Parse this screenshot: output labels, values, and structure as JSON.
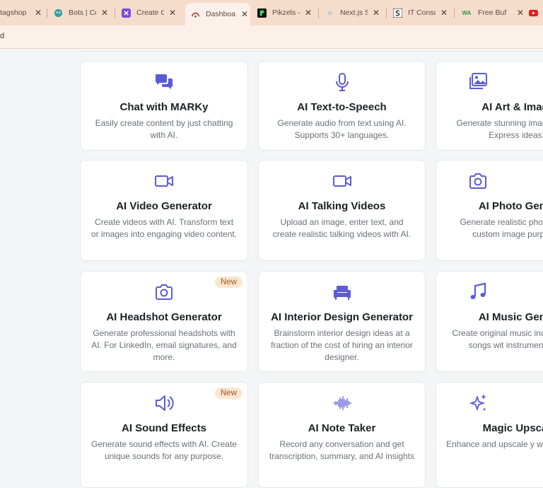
{
  "browser": {
    "tabs": [
      {
        "title": "tagshop",
        "icon": "tagshop-icon"
      },
      {
        "title": "Bots | Co",
        "icon": "bot-icon"
      },
      {
        "title": "Create C",
        "icon": "create-icon"
      },
      {
        "title": "Dashboa",
        "icon": "dashboard-icon",
        "active": true
      },
      {
        "title": "Pikzels -",
        "icon": "pikzels-icon"
      },
      {
        "title": "Next.js S",
        "icon": "nextjs-icon"
      },
      {
        "title": "IT Consu",
        "icon": "it-consult-icon"
      },
      {
        "title": "Free Buf",
        "icon": "whatsapp-icon",
        "icon_text": "WA"
      },
      {
        "title": "",
        "icon": "youtube-icon"
      }
    ],
    "url_fragment": "d"
  },
  "colors": {
    "accent": "#5b5bd6",
    "badge_bg": "#fde6cf",
    "badge_text": "#9a5a2a"
  },
  "cards": [
    {
      "title": "Chat with MARKy",
      "desc": "Easily create content by just chatting with AI.",
      "icon": "chat-icon"
    },
    {
      "title": "AI Text-to-Speech",
      "desc": "Generate audio from text using AI. Supports 30+ languages.",
      "icon": "microphone-icon"
    },
    {
      "title": "AI Art & Imag",
      "desc": "Generate stunning imag with AI. Express ideas.",
      "icon": "images-icon"
    },
    {
      "title": "AI Video Generator",
      "desc": "Create videos with AI. Transform text or images into engaging video content.",
      "icon": "video-icon"
    },
    {
      "title": "AI Talking Videos",
      "desc": "Upload an image, enter text, and create realistic talking videos with AI.",
      "icon": "video-icon"
    },
    {
      "title": "AI Photo Gene",
      "desc": "Generate realistic phot Create custom image purpose.",
      "icon": "camera-icon"
    },
    {
      "title": "AI Headshot Generator",
      "desc": "Generate professional headshots with AI. For LinkedIn, email signatures, and more.",
      "icon": "camera-icon",
      "badge": "New"
    },
    {
      "title": "AI Interior Design Generator",
      "desc": "Brainstorm interior design ideas at a fraction of the cost of hiring an interior designer.",
      "icon": "couch-icon"
    },
    {
      "title": "AI Music Gene",
      "desc": "Create original music including full songs wit instrumental tra",
      "icon": "music-note-icon"
    },
    {
      "title": "AI Sound Effects",
      "desc": "Generate sound effects with AI. Create unique sounds for any purpose.",
      "icon": "speaker-icon",
      "badge": "New"
    },
    {
      "title": "AI Note Taker",
      "desc": "Record any conversation and get transcription, summary, and AI insights",
      "icon": "waveform-icon"
    },
    {
      "title": "Magic Upsca",
      "desc": "Enhance and upscale y with AI magic",
      "icon": "sparkles-icon"
    }
  ]
}
